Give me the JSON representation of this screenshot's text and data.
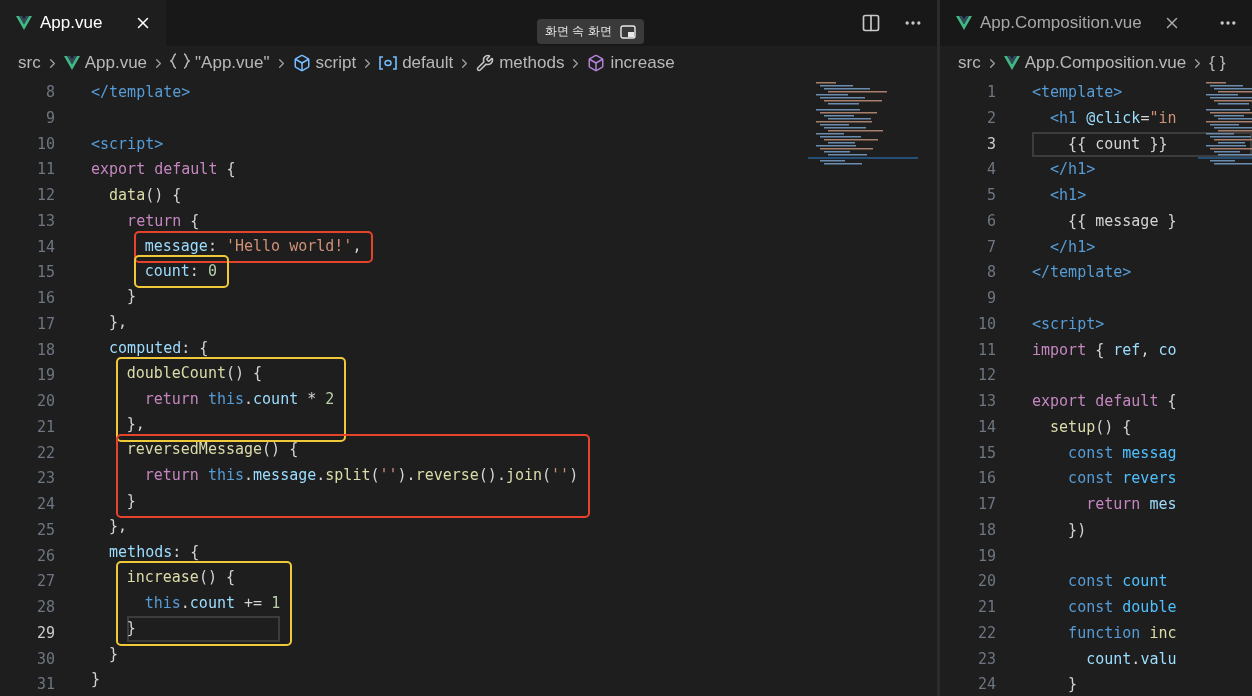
{
  "tooltip": {
    "label": "화면 속 화면"
  },
  "left_editor": {
    "tab": {
      "label": "App.vue",
      "selected": true
    },
    "breadcrumbs": [
      {
        "kind": "plain",
        "label": "src"
      },
      {
        "kind": "vue",
        "label": "App.vue"
      },
      {
        "kind": "braces",
        "label": "\"App.vue\""
      },
      {
        "kind": "cube",
        "label": "script"
      },
      {
        "kind": "namespace",
        "label": "default"
      },
      {
        "kind": "wrench",
        "label": "methods"
      },
      {
        "kind": "method",
        "label": "increase"
      }
    ],
    "lines": [
      {
        "n": "8",
        "current": false,
        "code": [
          {
            "kind": "tag",
            "text": "</template>"
          }
        ]
      },
      {
        "n": "9",
        "current": false
      },
      {
        "n": "10",
        "current": false,
        "code": [
          {
            "kind": "tag",
            "text": "<script>"
          }
        ]
      },
      {
        "n": "11",
        "current": false,
        "code": [
          {
            "kind": "kw",
            "text": "export default"
          },
          {
            "kind": "plain",
            "text": " {"
          }
        ]
      },
      {
        "n": "12",
        "current": false,
        "code": [
          {
            "kind": "func",
            "text": "  data"
          },
          {
            "kind": "plain",
            "text": "() {"
          }
        ]
      },
      {
        "n": "13",
        "current": false,
        "code": [
          {
            "kind": "kw",
            "text": "    return"
          },
          {
            "kind": "plain",
            "text": " {"
          }
        ]
      },
      {
        "kind": "box",
        "color": "#e5432b",
        "lines": [
          {
            "n": "14",
            "current": false,
            "code": [
              {
                "kind": "prop",
                "text": "message"
              },
              {
                "kind": "plain",
                "text": ": "
              },
              {
                "kind": "str",
                "text": "'Hello world!'"
              },
              {
                "kind": "plain",
                "text": ","
              }
            ]
          }
        ]
      },
      {
        "kind": "box",
        "color": "#f0c93a",
        "lines": [
          {
            "n": "15",
            "current": false,
            "code": [
              {
                "kind": "prop",
                "text": "count"
              },
              {
                "kind": "plain",
                "text": ": "
              },
              {
                "kind": "num",
                "text": "0"
              }
            ]
          }
        ]
      },
      {
        "n": "16",
        "current": false,
        "code": [
          {
            "kind": "plain",
            "text": "    }"
          }
        ]
      },
      {
        "n": "17",
        "current": false,
        "code": [
          {
            "kind": "plain",
            "text": "  },"
          }
        ]
      },
      {
        "n": "18",
        "current": false,
        "code": [
          {
            "kind": "prop",
            "text": "  computed"
          },
          {
            "kind": "plain",
            "text": ": {"
          }
        ]
      },
      {
        "kind": "box",
        "color": "#f0c93a",
        "lines": [
          {
            "n": "19",
            "current": false,
            "code": [
              {
                "kind": "func",
                "text": "doubleCount"
              },
              {
                "kind": "plain",
                "text": "() {"
              }
            ]
          },
          {
            "n": "20",
            "current": false,
            "code": [
              {
                "kind": "kw",
                "text": "  return"
              },
              {
                "kind": "this",
                "text": " this"
              },
              {
                "kind": "plain",
                "text": "."
              },
              {
                "kind": "prop",
                "text": "count"
              },
              {
                "kind": "plain",
                "text": " * "
              },
              {
                "kind": "num",
                "text": "2"
              }
            ]
          },
          {
            "n": "21",
            "current": false,
            "code": [
              {
                "kind": "plain",
                "text": "},"
              }
            ]
          }
        ]
      },
      {
        "kind": "box",
        "color": "#e5432b",
        "lines": [
          {
            "n": "22",
            "current": false,
            "code": [
              {
                "kind": "func",
                "text": "reversedMessage"
              },
              {
                "kind": "plain",
                "text": "() {"
              }
            ]
          },
          {
            "n": "23",
            "current": false,
            "code": [
              {
                "kind": "kw",
                "text": "  return"
              },
              {
                "kind": "this",
                "text": " this"
              },
              {
                "kind": "plain",
                "text": "."
              },
              {
                "kind": "prop",
                "text": "message"
              },
              {
                "kind": "plain",
                "text": "."
              },
              {
                "kind": "func",
                "text": "split"
              },
              {
                "kind": "plain",
                "text": "("
              },
              {
                "kind": "str",
                "text": "''"
              },
              {
                "kind": "plain",
                "text": ")."
              },
              {
                "kind": "func",
                "text": "reverse"
              },
              {
                "kind": "plain",
                "text": "()."
              },
              {
                "kind": "func",
                "text": "join"
              },
              {
                "kind": "plain",
                "text": "("
              },
              {
                "kind": "str",
                "text": "''"
              },
              {
                "kind": "plain",
                "text": ")"
              }
            ]
          },
          {
            "n": "24",
            "current": false,
            "code": [
              {
                "kind": "plain",
                "text": "}"
              }
            ]
          }
        ]
      },
      {
        "n": "25",
        "current": false,
        "code": [
          {
            "kind": "plain",
            "text": "  },"
          }
        ]
      },
      {
        "n": "26",
        "current": false,
        "code": [
          {
            "kind": "prop",
            "text": "  methods"
          },
          {
            "kind": "plain",
            "text": ": {"
          }
        ]
      },
      {
        "kind": "box",
        "color": "#f0c93a",
        "lines": [
          {
            "n": "27",
            "current": false,
            "code": [
              {
                "kind": "func",
                "text": "increase"
              },
              {
                "kind": "plain",
                "text": "() {"
              }
            ]
          },
          {
            "n": "28",
            "current": false,
            "code": [
              {
                "kind": "this",
                "text": "  this"
              },
              {
                "kind": "plain",
                "text": "."
              },
              {
                "kind": "prop",
                "text": "count"
              },
              {
                "kind": "plain",
                "text": " += "
              },
              {
                "kind": "num",
                "text": "1"
              }
            ]
          },
          {
            "n": "29",
            "current": true,
            "code": [
              {
                "kind": "plain",
                "text": "}"
              }
            ]
          }
        ]
      },
      {
        "n": "30",
        "current": false,
        "code": [
          {
            "kind": "plain",
            "text": "  }"
          }
        ]
      },
      {
        "n": "31",
        "current": false,
        "code": [
          {
            "kind": "plain",
            "text": "}"
          }
        ]
      }
    ]
  },
  "right_editor": {
    "tab": {
      "label": "App.Composition.vue",
      "selected": false
    },
    "breadcrumbs": [
      {
        "kind": "plain",
        "label": "src"
      },
      {
        "kind": "vue",
        "label": "App.Composition.vue"
      },
      {
        "kind": "plain",
        "label": "{ }"
      }
    ],
    "lines": [
      {
        "n": "1",
        "current": false,
        "code": [
          {
            "kind": "tag",
            "text": "<template>"
          }
        ]
      },
      {
        "n": "2",
        "current": false,
        "code": [
          {
            "kind": "tag",
            "text": "  <h1"
          },
          {
            "kind": "prop",
            "text": " @click"
          },
          {
            "kind": "plain",
            "text": "="
          },
          {
            "kind": "str",
            "text": "\"in"
          }
        ]
      },
      {
        "n": "3",
        "current": true,
        "code": [
          {
            "kind": "plain",
            "text": "    {{ count }}"
          }
        ]
      },
      {
        "n": "4",
        "current": false,
        "code": [
          {
            "kind": "tag",
            "text": "  </h1>"
          }
        ]
      },
      {
        "n": "5",
        "current": false,
        "code": [
          {
            "kind": "tag",
            "text": "  <h1>"
          }
        ]
      },
      {
        "n": "6",
        "current": false,
        "code": [
          {
            "kind": "plain",
            "text": "    {{ message }"
          }
        ]
      },
      {
        "n": "7",
        "current": false,
        "code": [
          {
            "kind": "tag",
            "text": "  </h1>"
          }
        ]
      },
      {
        "n": "8",
        "current": false,
        "code": [
          {
            "kind": "tag",
            "text": "</template>"
          }
        ]
      },
      {
        "n": "9",
        "current": false
      },
      {
        "n": "10",
        "current": false,
        "code": [
          {
            "kind": "tag",
            "text": "<script>"
          }
        ]
      },
      {
        "n": "11",
        "current": false,
        "code": [
          {
            "kind": "kw",
            "text": "import"
          },
          {
            "kind": "plain",
            "text": " { "
          },
          {
            "kind": "prop",
            "text": "ref"
          },
          {
            "kind": "plain",
            "text": ", "
          },
          {
            "kind": "prop",
            "text": "co"
          }
        ]
      },
      {
        "n": "12",
        "current": false
      },
      {
        "n": "13",
        "current": false,
        "code": [
          {
            "kind": "kw",
            "text": "export default"
          },
          {
            "kind": "plain",
            "text": " {"
          }
        ]
      },
      {
        "n": "14",
        "current": false,
        "code": [
          {
            "kind": "func",
            "text": "  setup"
          },
          {
            "kind": "plain",
            "text": "() {"
          }
        ]
      },
      {
        "n": "15",
        "current": false,
        "code": [
          {
            "kind": "this",
            "text": "    const"
          },
          {
            "kind": "const",
            "text": " messag"
          }
        ]
      },
      {
        "n": "16",
        "current": false,
        "code": [
          {
            "kind": "this",
            "text": "    const"
          },
          {
            "kind": "const",
            "text": " revers"
          }
        ]
      },
      {
        "n": "17",
        "current": false,
        "code": [
          {
            "kind": "kw",
            "text": "      return"
          },
          {
            "kind": "prop",
            "text": " mes"
          }
        ]
      },
      {
        "n": "18",
        "current": false,
        "code": [
          {
            "kind": "plain",
            "text": "    })"
          }
        ]
      },
      {
        "n": "19",
        "current": false
      },
      {
        "n": "20",
        "current": false,
        "code": [
          {
            "kind": "this",
            "text": "    const"
          },
          {
            "kind": "const",
            "text": " count"
          }
        ]
      },
      {
        "n": "21",
        "current": false,
        "code": [
          {
            "kind": "this",
            "text": "    const"
          },
          {
            "kind": "const",
            "text": " double"
          }
        ]
      },
      {
        "n": "22",
        "current": false,
        "code": [
          {
            "kind": "this",
            "text": "    function"
          },
          {
            "kind": "func",
            "text": " inc"
          }
        ]
      },
      {
        "n": "23",
        "current": false,
        "code": [
          {
            "kind": "prop",
            "text": "      count"
          },
          {
            "kind": "plain",
            "text": "."
          },
          {
            "kind": "prop",
            "text": "valu"
          }
        ]
      },
      {
        "n": "24",
        "current": false,
        "code": [
          {
            "kind": "plain",
            "text": "    }"
          }
        ]
      }
    ]
  }
}
